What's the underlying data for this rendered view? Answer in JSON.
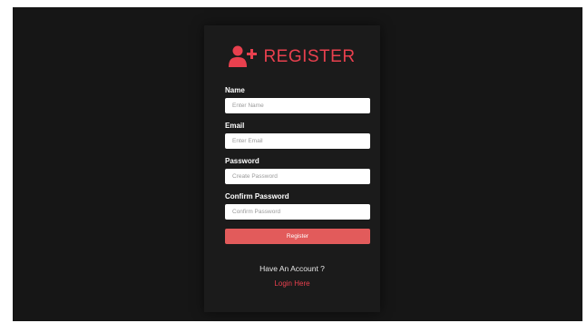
{
  "header": {
    "icon": "user-plus-icon",
    "title": "REGISTER"
  },
  "form": {
    "name": {
      "label": "Name",
      "placeholder": "Enter Name"
    },
    "email": {
      "label": "Email",
      "placeholder": "Enter Email"
    },
    "password": {
      "label": "Password",
      "placeholder": "Create Password"
    },
    "confirm_password": {
      "label": "Confirm Password",
      "placeholder": "Confirm Password"
    },
    "submit_label": "Register"
  },
  "footer": {
    "prompt": "Have An Account ?",
    "link_label": "Login Here"
  },
  "colors": {
    "background": "#161616",
    "card": "#1b1b1b",
    "accent": "#e8404e",
    "button": "#e25b5b"
  }
}
